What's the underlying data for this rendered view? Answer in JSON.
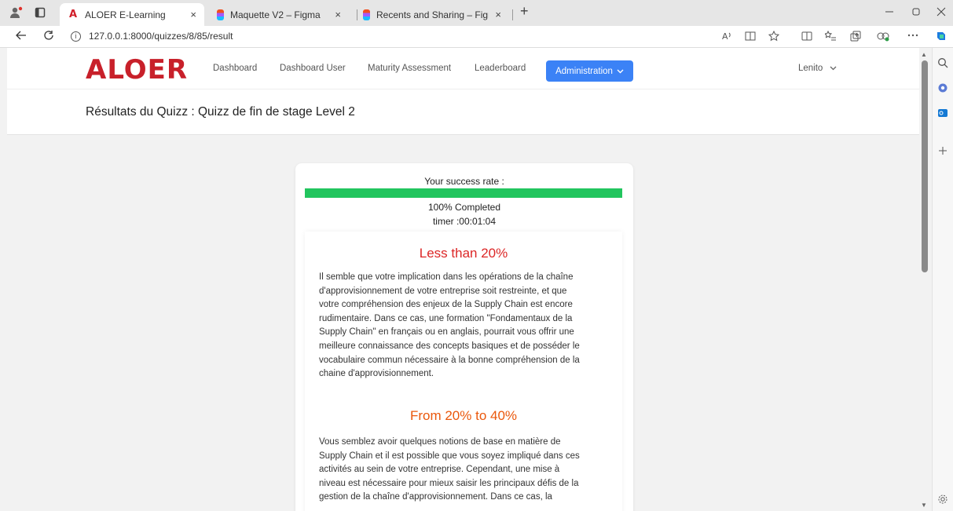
{
  "browser": {
    "tabs": [
      {
        "label": "ALOER E-Learning",
        "favicon": "aloer-icon",
        "active": true
      },
      {
        "label": "Maquette V2 – Figma",
        "favicon": "figma-icon",
        "active": false
      },
      {
        "label": "Recents and Sharing – Figma",
        "favicon": "figma-icon",
        "active": false
      }
    ],
    "close_glyph": "×",
    "new_tab_glyph": "+",
    "url": "127.0.0.1:8000/quizzes/8/85/result"
  },
  "nav": {
    "logo": "ALOER",
    "links": [
      "Dashboard",
      "Dashboard User",
      "Maturity Assessment",
      "Leaderboard"
    ],
    "admin_label": "Administration",
    "user": "Lenito"
  },
  "header": {
    "title": "Résultats du Quizz : Quizz de fin de stage Level 2"
  },
  "result": {
    "rate_label": "Your success rate :",
    "progress_fraction": 1.0,
    "completed_text": "100% Completed",
    "timer_text": "timer :00:01:04",
    "sections": [
      {
        "title": "Less than 20%",
        "lines": [
          "Il semble que votre implication dans les opérations de la chaîne",
          "d'approvisionnement de votre entreprise soit restreinte, et que",
          "votre compréhension des enjeux de la Supply Chain est encore",
          "rudimentaire. Dans ce cas, une formation \"Fondamentaux de la",
          "Supply Chain\" en français ou en anglais, pourrait vous offrir une",
          "meilleure connaissance des concepts basiques et de posséder le",
          "vocabulaire commun nécessaire à la bonne compréhension de la",
          "chaine d'approvisionnement."
        ]
      },
      {
        "title": "From 20% to 40%",
        "lines": [
          "Vous semblez avoir quelques notions de base en matière de",
          "Supply Chain et il est possible que vous soyez impliqué dans ces",
          "activités au sein de votre entreprise. Cependant, une mise à",
          "niveau est nécessaire pour mieux saisir les principaux défis de la",
          "gestion de la chaîne d'approvisionnement. Dans ce cas, la"
        ]
      }
    ]
  }
}
